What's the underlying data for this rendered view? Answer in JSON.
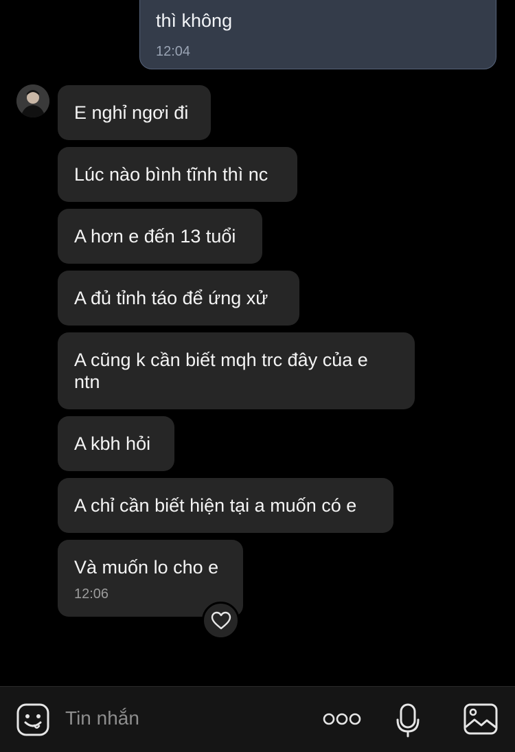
{
  "chat": {
    "outgoing_last": {
      "text_cut": "",
      "text": "thì không",
      "time": "12:04"
    },
    "incoming": [
      {
        "text": "E nghỉ ngơi đi"
      },
      {
        "text": "Lúc nào bình tĩnh thì nc"
      },
      {
        "text": "A hơn e đến 13 tuổi"
      },
      {
        "text": "A đủ tỉnh táo để ứng xử"
      },
      {
        "text": "A cũng k cần biết mqh trc đây của e\nntn"
      },
      {
        "text": "A kbh hỏi"
      },
      {
        "text": "A chỉ cần biết hiện tại a muốn có e"
      },
      {
        "text": "Và muốn lo cho e",
        "time": "12:06"
      }
    ],
    "reaction": "heart-icon"
  },
  "composer": {
    "placeholder": "Tin nhắn",
    "icons": [
      "sticker-icon",
      "more-icon",
      "microphone-icon",
      "image-icon"
    ]
  },
  "colors": {
    "background": "#000000",
    "incoming_bubble": "#262626",
    "outgoing_bubble": "#343c4a",
    "outgoing_border": "#56637a"
  }
}
